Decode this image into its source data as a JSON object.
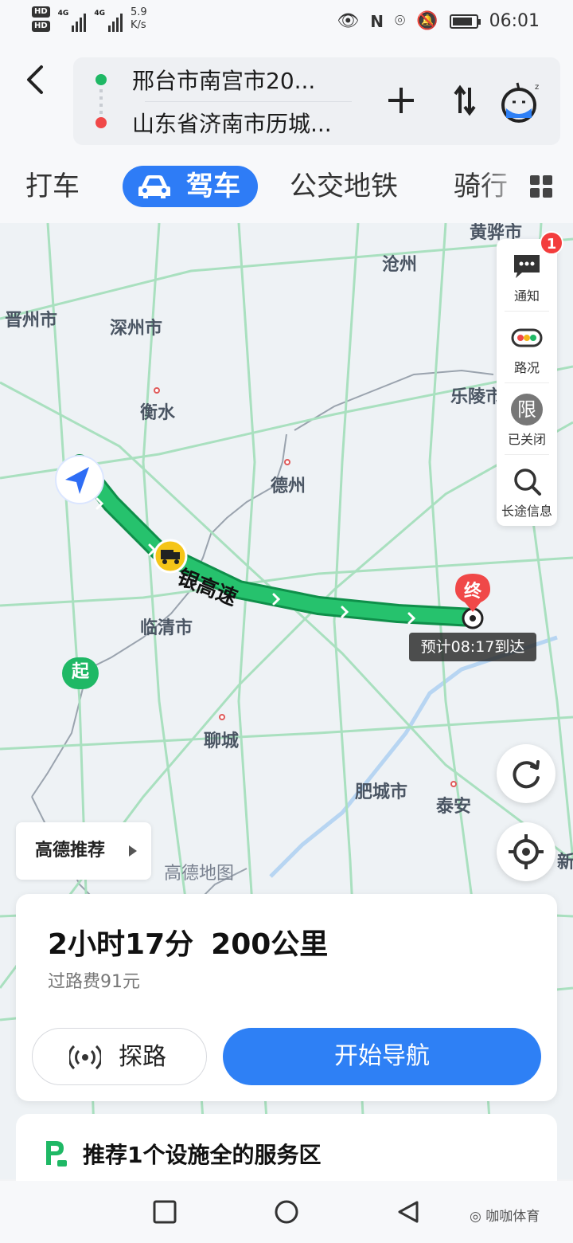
{
  "status_bar": {
    "network_speed_value": "5.9",
    "network_speed_unit": "K/s",
    "time": "06:01"
  },
  "route": {
    "origin": "邢台市南宫市20...",
    "destination": "山东省济南市历城..."
  },
  "tabs": [
    {
      "label": "打车",
      "active": false
    },
    {
      "label": "驾车",
      "active": true
    },
    {
      "label": "公交地铁",
      "active": false
    },
    {
      "label": "骑行",
      "active": false
    }
  ],
  "map": {
    "cities": [
      "沧州",
      "晋州市",
      "深州市",
      "衡水",
      "乐陵市",
      "德州",
      "临清市",
      "聊城",
      "肥城市",
      "泰安",
      "黄骅市",
      "新"
    ],
    "road_label": "银高速",
    "start_marker": "起",
    "end_marker": "终",
    "eta": "预计08:17到达",
    "watermark": "高德地图",
    "recommend_label": "高德推荐"
  },
  "side_panel": {
    "notify": {
      "label": "通知",
      "badge": "1"
    },
    "traffic": {
      "label": "路况"
    },
    "restriction": {
      "icon_text": "限",
      "label": "已关闭"
    },
    "longtrip": {
      "label": "长途信息"
    }
  },
  "summary": {
    "duration": "2小时17分",
    "distance": "200公里",
    "toll": "过路费91元",
    "explore_label": "探路",
    "navigate_label": "开始导航"
  },
  "service_area": {
    "text": "推荐1个设施全的服务区"
  },
  "footer": {
    "wechat_account": "咖咖体育"
  },
  "colors": {
    "accent_blue": "#2e80f5",
    "route_green": "#1fb865",
    "end_red": "#f04848"
  }
}
